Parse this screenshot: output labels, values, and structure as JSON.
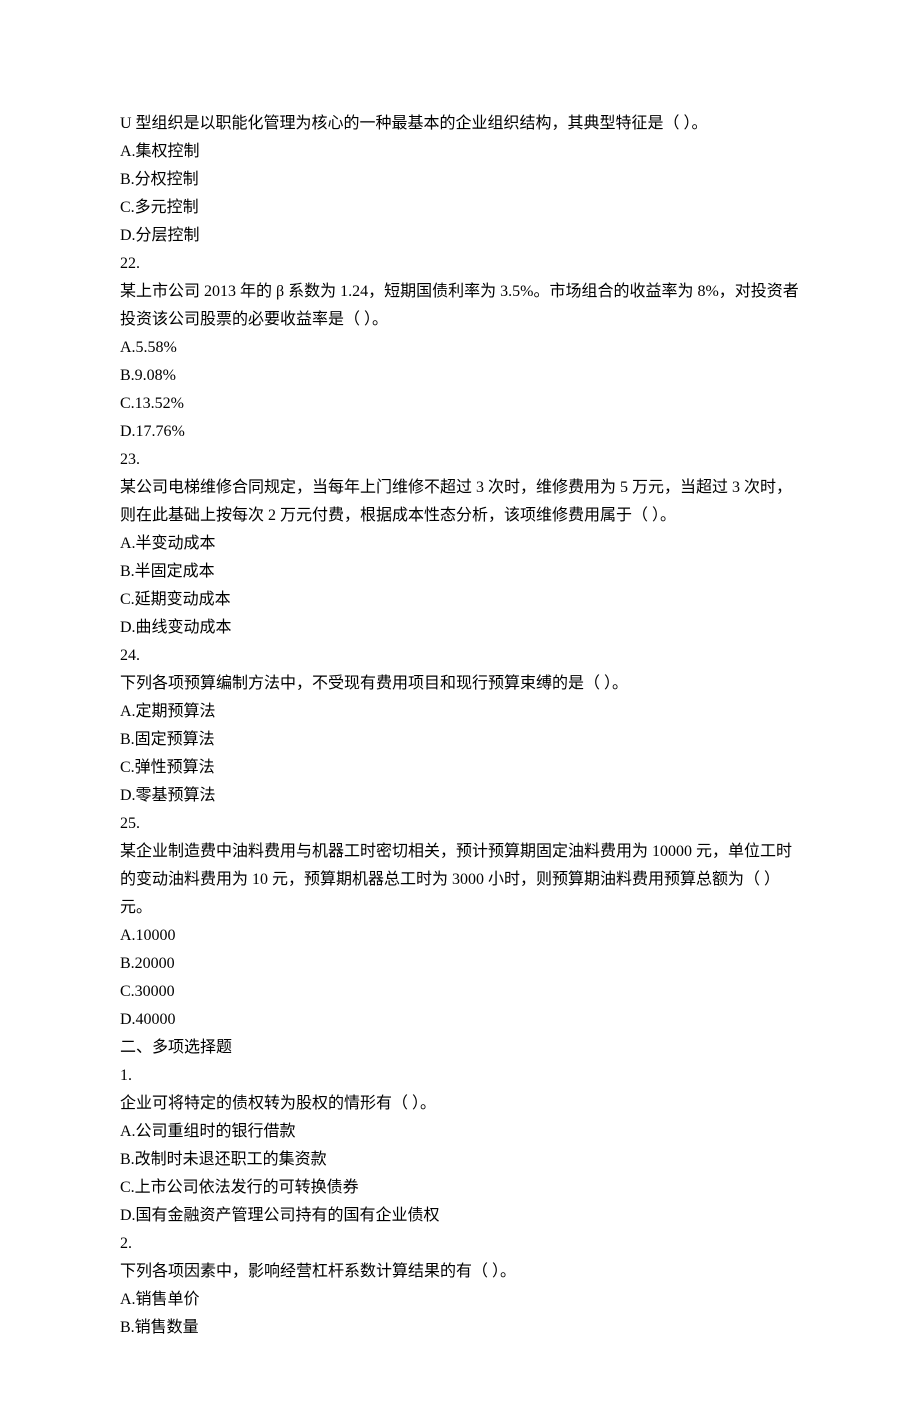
{
  "lines": [
    "U 型组织是以职能化管理为核心的一种最基本的企业组织结构，其典型特征是（ ）。",
    "A.集权控制",
    "B.分权控制",
    "C.多元控制",
    "D.分层控制",
    "22.",
    "某上市公司 2013 年的 β 系数为 1.24，短期国债利率为 3.5%。市场组合的收益率为 8%，对投资者投资该公司股票的必要收益率是（ ）。",
    "A.5.58%",
    "B.9.08%",
    "C.13.52%",
    "D.17.76%",
    "23.",
    "某公司电梯维修合同规定，当每年上门维修不超过 3 次时，维修费用为 5 万元，当超过 3 次时，则在此基础上按每次 2 万元付费，根据成本性态分析，该项维修费用属于（ ）。",
    "A.半变动成本",
    "B.半固定成本",
    "C.延期变动成本",
    "D.曲线变动成本",
    "24.",
    "下列各项预算编制方法中，不受现有费用项目和现行预算束缚的是（ ）。",
    "A.定期预算法",
    "B.固定预算法",
    "C.弹性预算法",
    "D.零基预算法",
    "25.",
    "某企业制造费中油料费用与机器工时密切相关，预计预算期固定油料费用为 10000 元，单位工时的变动油料费用为 10 元，预算期机器总工时为 3000 小时，则预算期油料费用预算总额为（ ）元。",
    "A.10000",
    "B.20000",
    "C.30000",
    "D.40000",
    "二、多项选择题",
    "1.",
    "企业可将特定的债权转为股权的情形有（ ）。",
    "A.公司重组时的银行借款",
    "B.改制时未退还职工的集资款",
    "C.上市公司依法发行的可转换债券",
    "D.国有金融资产管理公司持有的国有企业债权",
    "2.",
    "下列各项因素中，影响经营杠杆系数计算结果的有（ ）。",
    "A.销售单价",
    "B.销售数量"
  ]
}
